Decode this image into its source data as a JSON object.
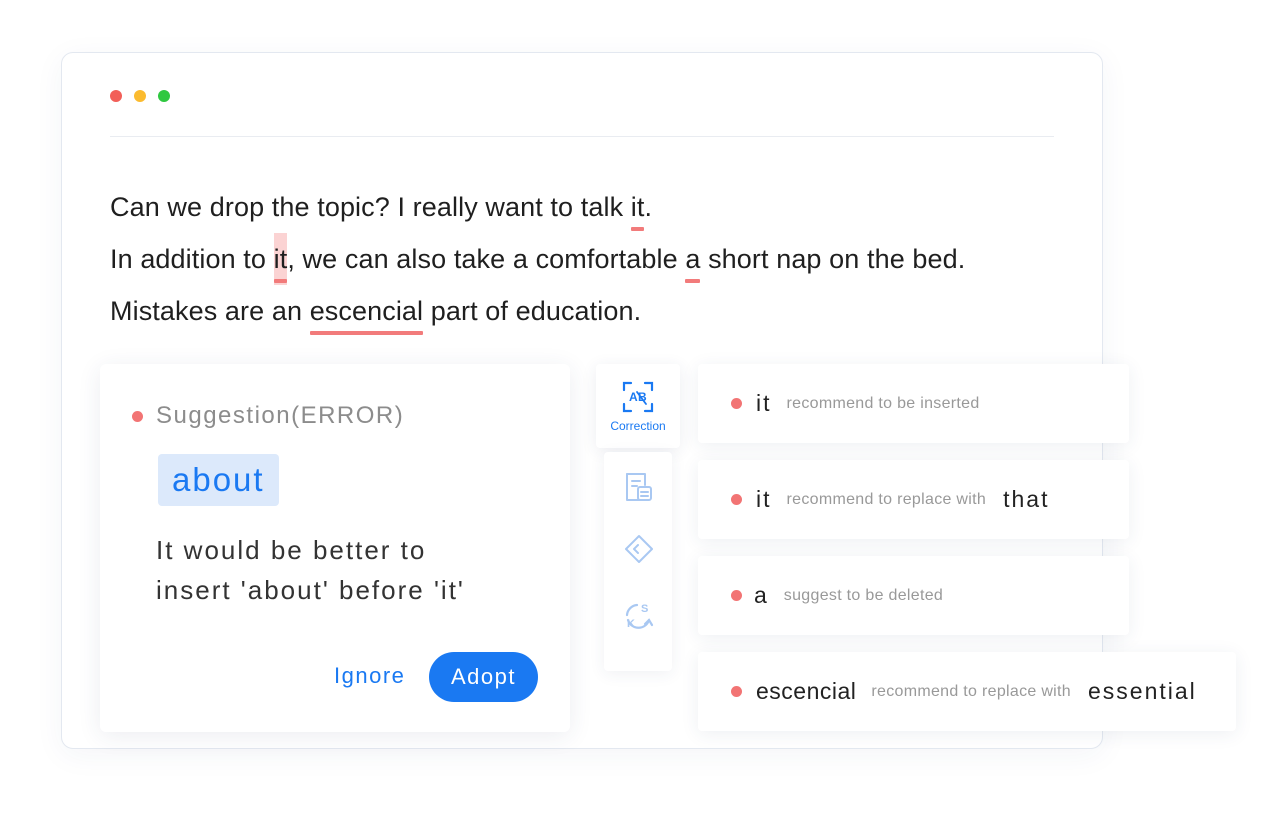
{
  "editor": {
    "line1": {
      "before": "Can we drop the topic? I really want to talk ",
      "mark": "it",
      "after": "."
    },
    "line2": {
      "before": "In addition to ",
      "mark1": "it",
      "middle": ", we can also take a comfortable ",
      "mark2": "a",
      "after": " short nap on the bed."
    },
    "line3": {
      "before": "Mistakes are an ",
      "mark": "escencial",
      "after": " part of education."
    }
  },
  "suggestion": {
    "header": "Suggestion(ERROR)",
    "word": "about",
    "description_line1": "It would be better to",
    "description_line2": "insert 'about' before 'it'",
    "ignore_label": "Ignore",
    "adopt_label": "Adopt"
  },
  "toolbar": {
    "active_label": "Correction",
    "icons": [
      "correction-icon",
      "document-icon",
      "tag-icon",
      "sync-icon"
    ],
    "accent_color": "#1a79f2"
  },
  "issues": [
    {
      "word": "it",
      "message": "recommend to be inserted",
      "replacement": ""
    },
    {
      "word": "it",
      "message": "recommend to replace with",
      "replacement": "that"
    },
    {
      "word": "a",
      "message": "suggest to be deleted",
      "replacement": ""
    },
    {
      "word": "escencial",
      "message": "recommend to replace with",
      "replacement": "essential"
    }
  ],
  "colors": {
    "error": "#f27474",
    "primary": "#1a79f2",
    "highlight": "#fbd3d3"
  }
}
